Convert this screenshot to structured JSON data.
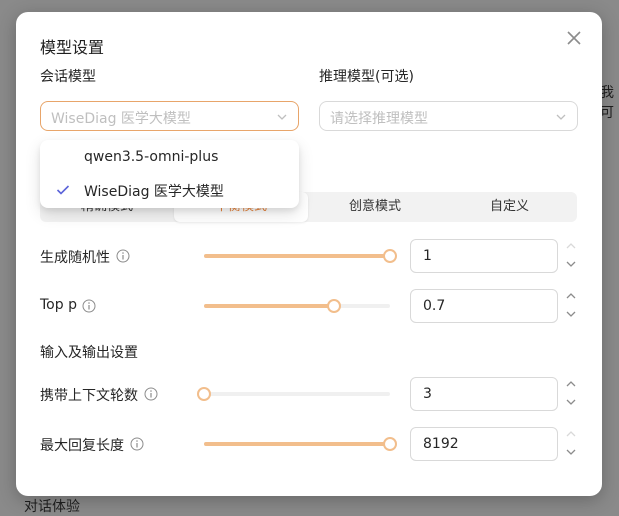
{
  "background": {
    "side_text": "我可",
    "bottom_text": "对话体验"
  },
  "modal": {
    "title": "模型设置",
    "chat_model": {
      "label": "会话模型",
      "placeholder": "WiseDiag 医学大模型"
    },
    "reasoning_model": {
      "label": "推理模型(可选)",
      "placeholder": "请选择推理模型"
    },
    "dropdown": {
      "options": [
        {
          "label": "qwen3.5-omni-plus",
          "selected": false
        },
        {
          "label": "WiseDiag 医学大模型",
          "selected": true
        }
      ]
    },
    "tabs": [
      {
        "label": "精确模式",
        "active": false
      },
      {
        "label": "平衡模式",
        "active": true
      },
      {
        "label": "创意模式",
        "active": false
      },
      {
        "label": "自定义",
        "active": false
      }
    ],
    "params": [
      {
        "label": "生成随机性",
        "value": "1",
        "fraction": 1.0
      },
      {
        "label": "Top p",
        "value": "0.7",
        "fraction": 0.7
      },
      {
        "label": "携带上下文轮数",
        "value": "3",
        "fraction": 0.0
      },
      {
        "label": "最大回复长度",
        "value": "8192",
        "fraction": 1.0
      }
    ],
    "io_section_label": "输入及输出设置"
  },
  "colors": {
    "accent": "#e8833a",
    "slider": "#f2be8c",
    "focus_border": "#e8a56a",
    "check": "#5b63d9"
  }
}
